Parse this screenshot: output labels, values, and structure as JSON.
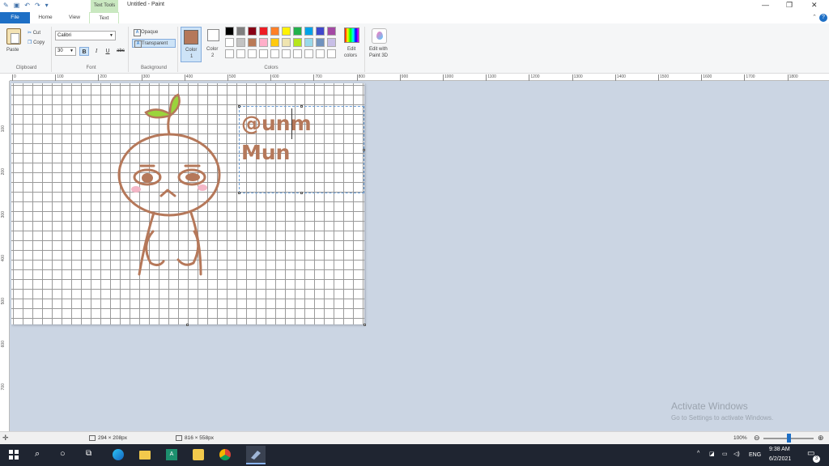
{
  "titlebar": {
    "context_tab": "Text Tools",
    "title": "Untitled - Paint",
    "minimize": "—",
    "maximize": "❐",
    "close": "✕"
  },
  "tabs": {
    "file": "File",
    "home": "Home",
    "view": "View",
    "text": "Text",
    "help": "?"
  },
  "clipboard": {
    "paste": "Paste",
    "cut": "Cut",
    "copy": "Copy",
    "group": "Clipboard"
  },
  "font": {
    "family": "Calibri",
    "size": "30",
    "bold": "B",
    "italic": "I",
    "underline": "U",
    "strike": "abc",
    "group": "Font"
  },
  "background": {
    "opaque": "Opaque",
    "transparent": "Transparent",
    "group": "Background"
  },
  "colors": {
    "color1": "Color\n1",
    "color1_l1": "Color",
    "color1_l2": "1",
    "color2_l1": "Color",
    "color2_l2": "2",
    "edit_l1": "Edit",
    "edit_l2": "colors",
    "p3d_l1": "Edit with",
    "p3d_l2": "Paint 3D",
    "group": "Colors",
    "active_color1": "#b5785a",
    "palette": [
      "#000000",
      "#7f7f7f",
      "#880015",
      "#ed1c24",
      "#ff7f27",
      "#fff200",
      "#22b14c",
      "#00a2e8",
      "#3f48cc",
      "#a349a4",
      "#ffffff",
      "#c3c3c3",
      "#b97a57",
      "#ffaec9",
      "#ffc90e",
      "#efe4b0",
      "#b5e61d",
      "#99d9ea",
      "#7092be",
      "#c8bfe7",
      "#ffffff",
      "#ffffff",
      "#ffffff",
      "#ffffff",
      "#ffffff",
      "#ffffff",
      "#ffffff",
      "#ffffff",
      "#ffffff",
      "#ffffff"
    ]
  },
  "rulers": {
    "h": [
      "0",
      "100",
      "200",
      "300",
      "400",
      "500",
      "600",
      "700",
      "800",
      "900",
      "1000",
      "1100",
      "1200",
      "1300",
      "1400",
      "1500",
      "1600",
      "1700",
      "1800"
    ],
    "v": [
      "100",
      "200",
      "300",
      "400",
      "500",
      "600",
      "700"
    ]
  },
  "canvas": {
    "text_line1": "@unm",
    "text_line2": "Mun",
    "stroke_color": "#b5785a",
    "leaf_color": "#9bd43c",
    "blush_color": "#f4b7c7"
  },
  "watermark": {
    "line1": "Activate Windows",
    "line2": "Go to Settings to activate Windows."
  },
  "status": {
    "selection": "294 × 208px",
    "canvas_size": "816 × 558px",
    "zoom": "100%"
  },
  "taskbar": {
    "lang": "ENG",
    "time": "9:38 AM",
    "date": "6/2/2021",
    "notif_count": "3"
  }
}
